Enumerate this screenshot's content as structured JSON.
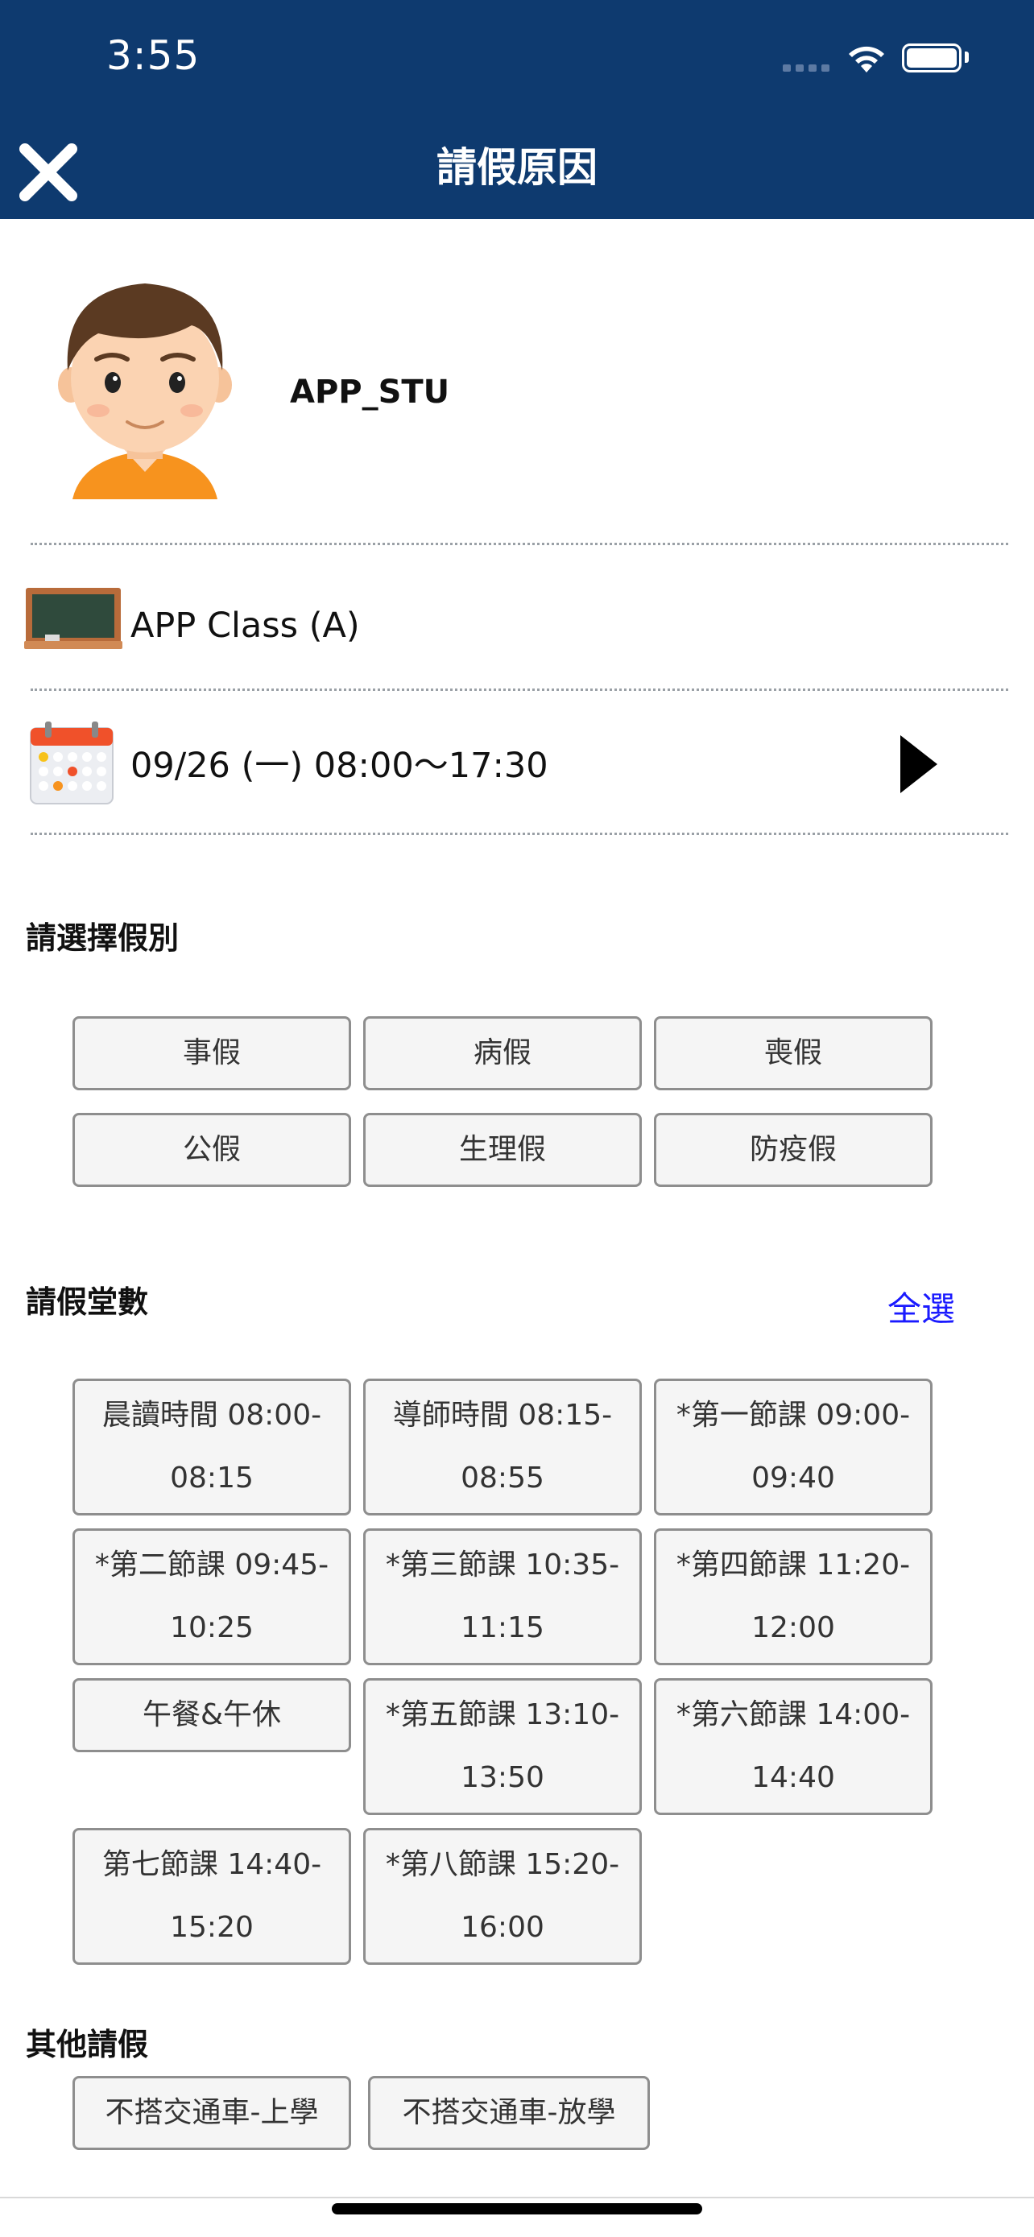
{
  "status_bar": {
    "time": "3:55"
  },
  "header": {
    "title": "請假原因"
  },
  "profile": {
    "name": "APP_STU"
  },
  "class_row": {
    "label": "APP Class (A)"
  },
  "date_row": {
    "label": "09/26 (一) 08:00～17:30"
  },
  "leave_types": {
    "title": "請選擇假別",
    "options": [
      "事假",
      "病假",
      "喪假",
      "公假",
      "生理假",
      "防疫假"
    ]
  },
  "periods": {
    "title": "請假堂數",
    "select_all": "全選",
    "items": [
      {
        "line1": "晨讀時間 08:00-",
        "line2": "08:15"
      },
      {
        "line1": "導師時間 08:15-",
        "line2": "08:55"
      },
      {
        "line1": "*第一節課 09:00-",
        "line2": "09:40"
      },
      {
        "line1": "*第二節課 09:45-",
        "line2": "10:25"
      },
      {
        "line1": "*第三節課 10:35-",
        "line2": "11:15"
      },
      {
        "line1": "*第四節課 11:20-",
        "line2": "12:00"
      },
      {
        "line1": "午餐&午休",
        "line2": ""
      },
      {
        "line1": "*第五節課 13:10-",
        "line2": "13:50"
      },
      {
        "line1": "*第六節課 14:00-",
        "line2": "14:40"
      },
      {
        "line1": "第七節課 14:40-",
        "line2": "15:20"
      },
      {
        "line1": "*第八節課 15:20-",
        "line2": "16:00"
      }
    ]
  },
  "other": {
    "title": "其他請假",
    "options": [
      "不搭交通車-上學",
      "不搭交通車-放學"
    ]
  },
  "colors": {
    "header": "#0e3a6f",
    "link": "#1a1aff",
    "chip_bg": "#f5f5f5",
    "chip_border": "#8e8e8e"
  }
}
